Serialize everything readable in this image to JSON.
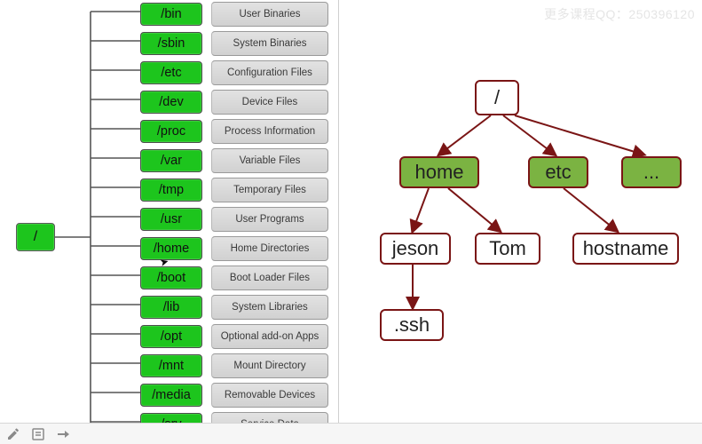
{
  "watermark": "更多课程QQ：250396120",
  "left": {
    "root": "/",
    "rows": [
      {
        "dir": "/bin",
        "desc": "User Binaries"
      },
      {
        "dir": "/sbin",
        "desc": "System Binaries"
      },
      {
        "dir": "/etc",
        "desc": "Configuration Files"
      },
      {
        "dir": "/dev",
        "desc": "Device Files"
      },
      {
        "dir": "/proc",
        "desc": "Process Information"
      },
      {
        "dir": "/var",
        "desc": "Variable Files"
      },
      {
        "dir": "/tmp",
        "desc": "Temporary Files"
      },
      {
        "dir": "/usr",
        "desc": "User Programs"
      },
      {
        "dir": "/home",
        "desc": "Home Directories"
      },
      {
        "dir": "/boot",
        "desc": "Boot Loader Files"
      },
      {
        "dir": "/lib",
        "desc": "System Libraries"
      },
      {
        "dir": "/opt",
        "desc": "Optional add-on Apps"
      },
      {
        "dir": "/mnt",
        "desc": "Mount Directory"
      },
      {
        "dir": "/media",
        "desc": "Removable Devices"
      },
      {
        "dir": "/srv",
        "desc": "Service Data"
      }
    ]
  },
  "tree": {
    "root": "/",
    "l1": {
      "home": "home",
      "etc": "etc",
      "more": "..."
    },
    "l2": {
      "jeson": "jeson",
      "tom": "Tom",
      "hostname": "hostname"
    },
    "l3": {
      "ssh": ".ssh"
    }
  },
  "colors": {
    "brightGreen": "#1dc51d",
    "olive": "#7bb342",
    "edge": "#7a1515",
    "grey": "#d4d4d4"
  }
}
